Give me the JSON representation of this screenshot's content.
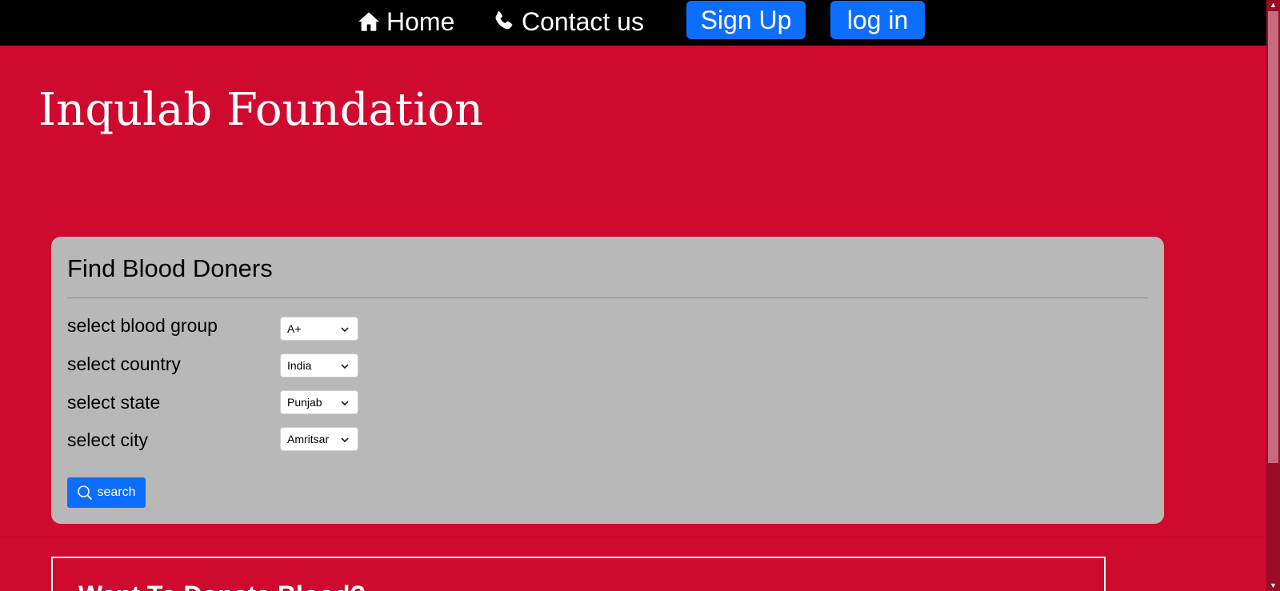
{
  "nav": {
    "home_label": "Home",
    "contact_label": "Contact us",
    "signup_label": "Sign Up",
    "login_label": "log in"
  },
  "brand": {
    "title": "Inqulab Foundation"
  },
  "finder": {
    "title": "Find Blood Doners",
    "blood_group_label": "select blood group",
    "blood_group_value": "A+",
    "country_label": "select country",
    "country_value": "India",
    "state_label": "select state",
    "state_value": "Punjab",
    "city_label": "select city",
    "city_value": "Amritsar",
    "search_label": "search"
  },
  "lower": {
    "title": "Want To Donate Blood?"
  },
  "colors": {
    "page_bg": "#ce0a2e",
    "nav_bg": "#000000",
    "primary_button": "#0d6efd",
    "card_bg": "#b8b8b8"
  },
  "icons": {
    "home": "home-icon",
    "phone": "phone-icon",
    "search": "search-icon",
    "chevron": "chevron-down-icon"
  }
}
